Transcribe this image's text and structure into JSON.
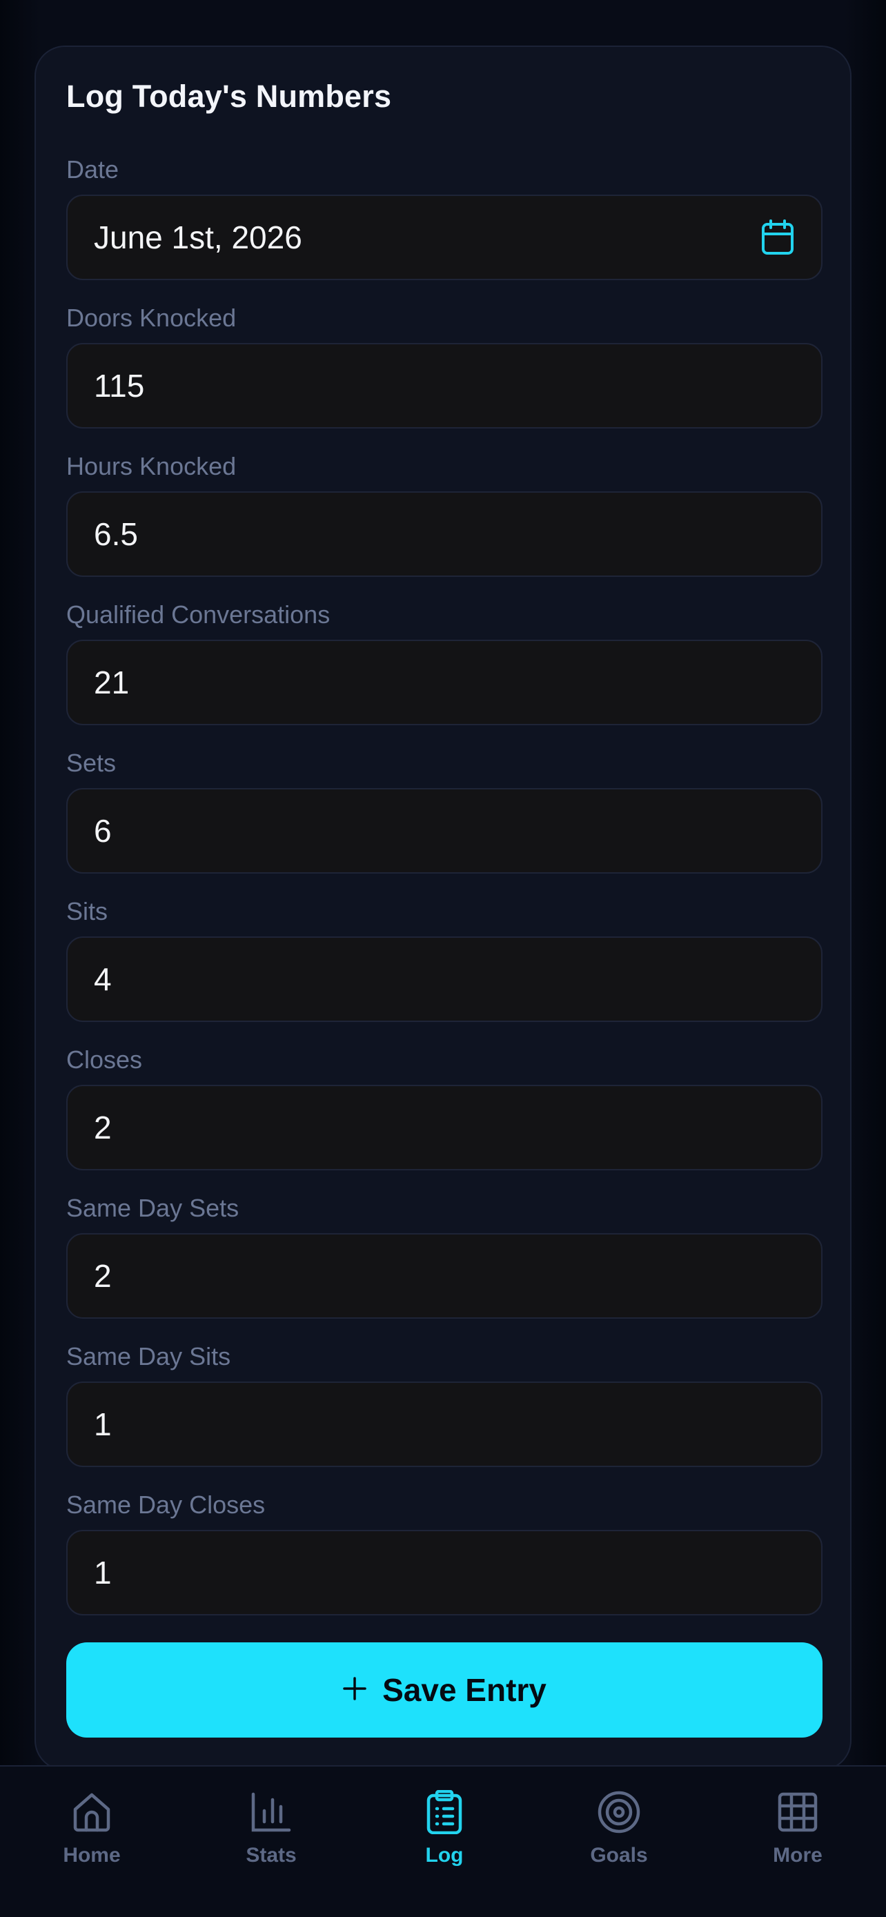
{
  "form": {
    "title": "Log Today's Numbers",
    "fields": [
      {
        "label": "Date",
        "value": "June 1st, 2026",
        "icon": "calendar-icon"
      },
      {
        "label": "Doors Knocked",
        "value": "115"
      },
      {
        "label": "Hours Knocked",
        "value": "6.5"
      },
      {
        "label": "Qualified Conversations",
        "value": "21"
      },
      {
        "label": "Sets",
        "value": "6"
      },
      {
        "label": "Sits",
        "value": "4"
      },
      {
        "label": "Closes",
        "value": "2"
      },
      {
        "label": "Same Day Sets",
        "value": "2"
      },
      {
        "label": "Same Day Sits",
        "value": "1"
      },
      {
        "label": "Same Day Closes",
        "value": "1"
      }
    ],
    "save_label": "Save Entry",
    "save_icon": "plus-icon"
  },
  "tabbar": {
    "active": "Log",
    "tabs": [
      {
        "label": "Home",
        "icon": "home-icon"
      },
      {
        "label": "Stats",
        "icon": "bar-chart-icon"
      },
      {
        "label": "Log",
        "icon": "clipboard-list-icon"
      },
      {
        "label": "Goals",
        "icon": "target-icon"
      },
      {
        "label": "More",
        "icon": "grid-icon"
      }
    ]
  },
  "colors": {
    "background": "#080c17",
    "card": "#0e1321",
    "input": "#131315",
    "accent": "#1ee1fc",
    "label": "#6b7794",
    "tab_inactive": "#5d6986",
    "tab_active": "#22d3ee"
  }
}
